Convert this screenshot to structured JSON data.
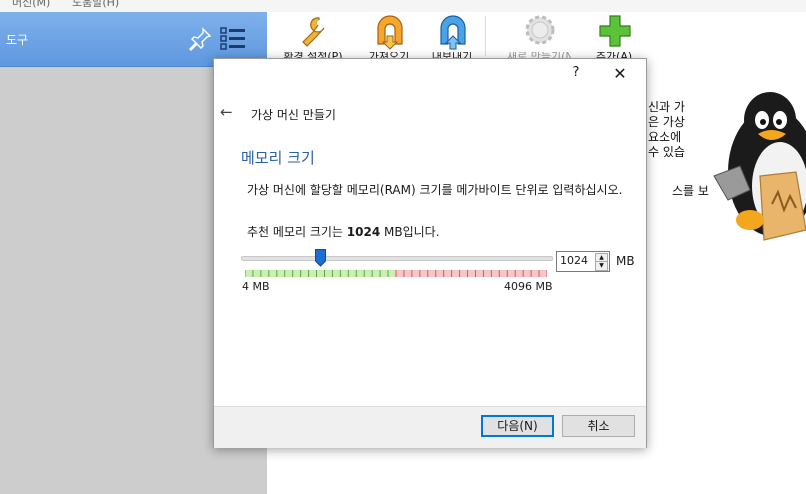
{
  "menubar": {
    "machine": "머신(M)",
    "help": "도움말(H)"
  },
  "left_pane": {
    "tools_label": "도구"
  },
  "toolbar": {
    "items": [
      {
        "label": "환경 설정(P)"
      },
      {
        "label": "가져오기"
      },
      {
        "label": "내보내기"
      },
      {
        "label": "새로 만들기(N)"
      },
      {
        "label": "추가(A)"
      }
    ]
  },
  "welcome": {
    "lines": [
      "신과 가",
      "은 가상",
      "요소에",
      "수 있습",
      "스를 보"
    ]
  },
  "dialog": {
    "help": "?",
    "close": "✕",
    "back": "←",
    "wizard_title": "가상 머신 만들기",
    "page_title": "메모리 크기",
    "description": "가상 머신에 할당할 메모리(RAM) 크기를 메가바이트 단위로 입력하십시오.",
    "recommend_prefix": "추천 메모리 크기는 ",
    "recommend_value": "1024",
    "recommend_suffix": " MB입니다.",
    "slider": {
      "min": 4,
      "max": 4096,
      "value": 1024
    },
    "min_label": "4 MB",
    "max_label": "4096 MB",
    "spin_value": "1024",
    "unit": "MB",
    "next_label": "다음(N)",
    "cancel_label": "취소"
  },
  "colors": {
    "accent_blue": "#2a5ea8",
    "tools_bg": "#6ea4e6",
    "slider_green": "#9fe07a",
    "slider_red": "#f0a0a0"
  }
}
